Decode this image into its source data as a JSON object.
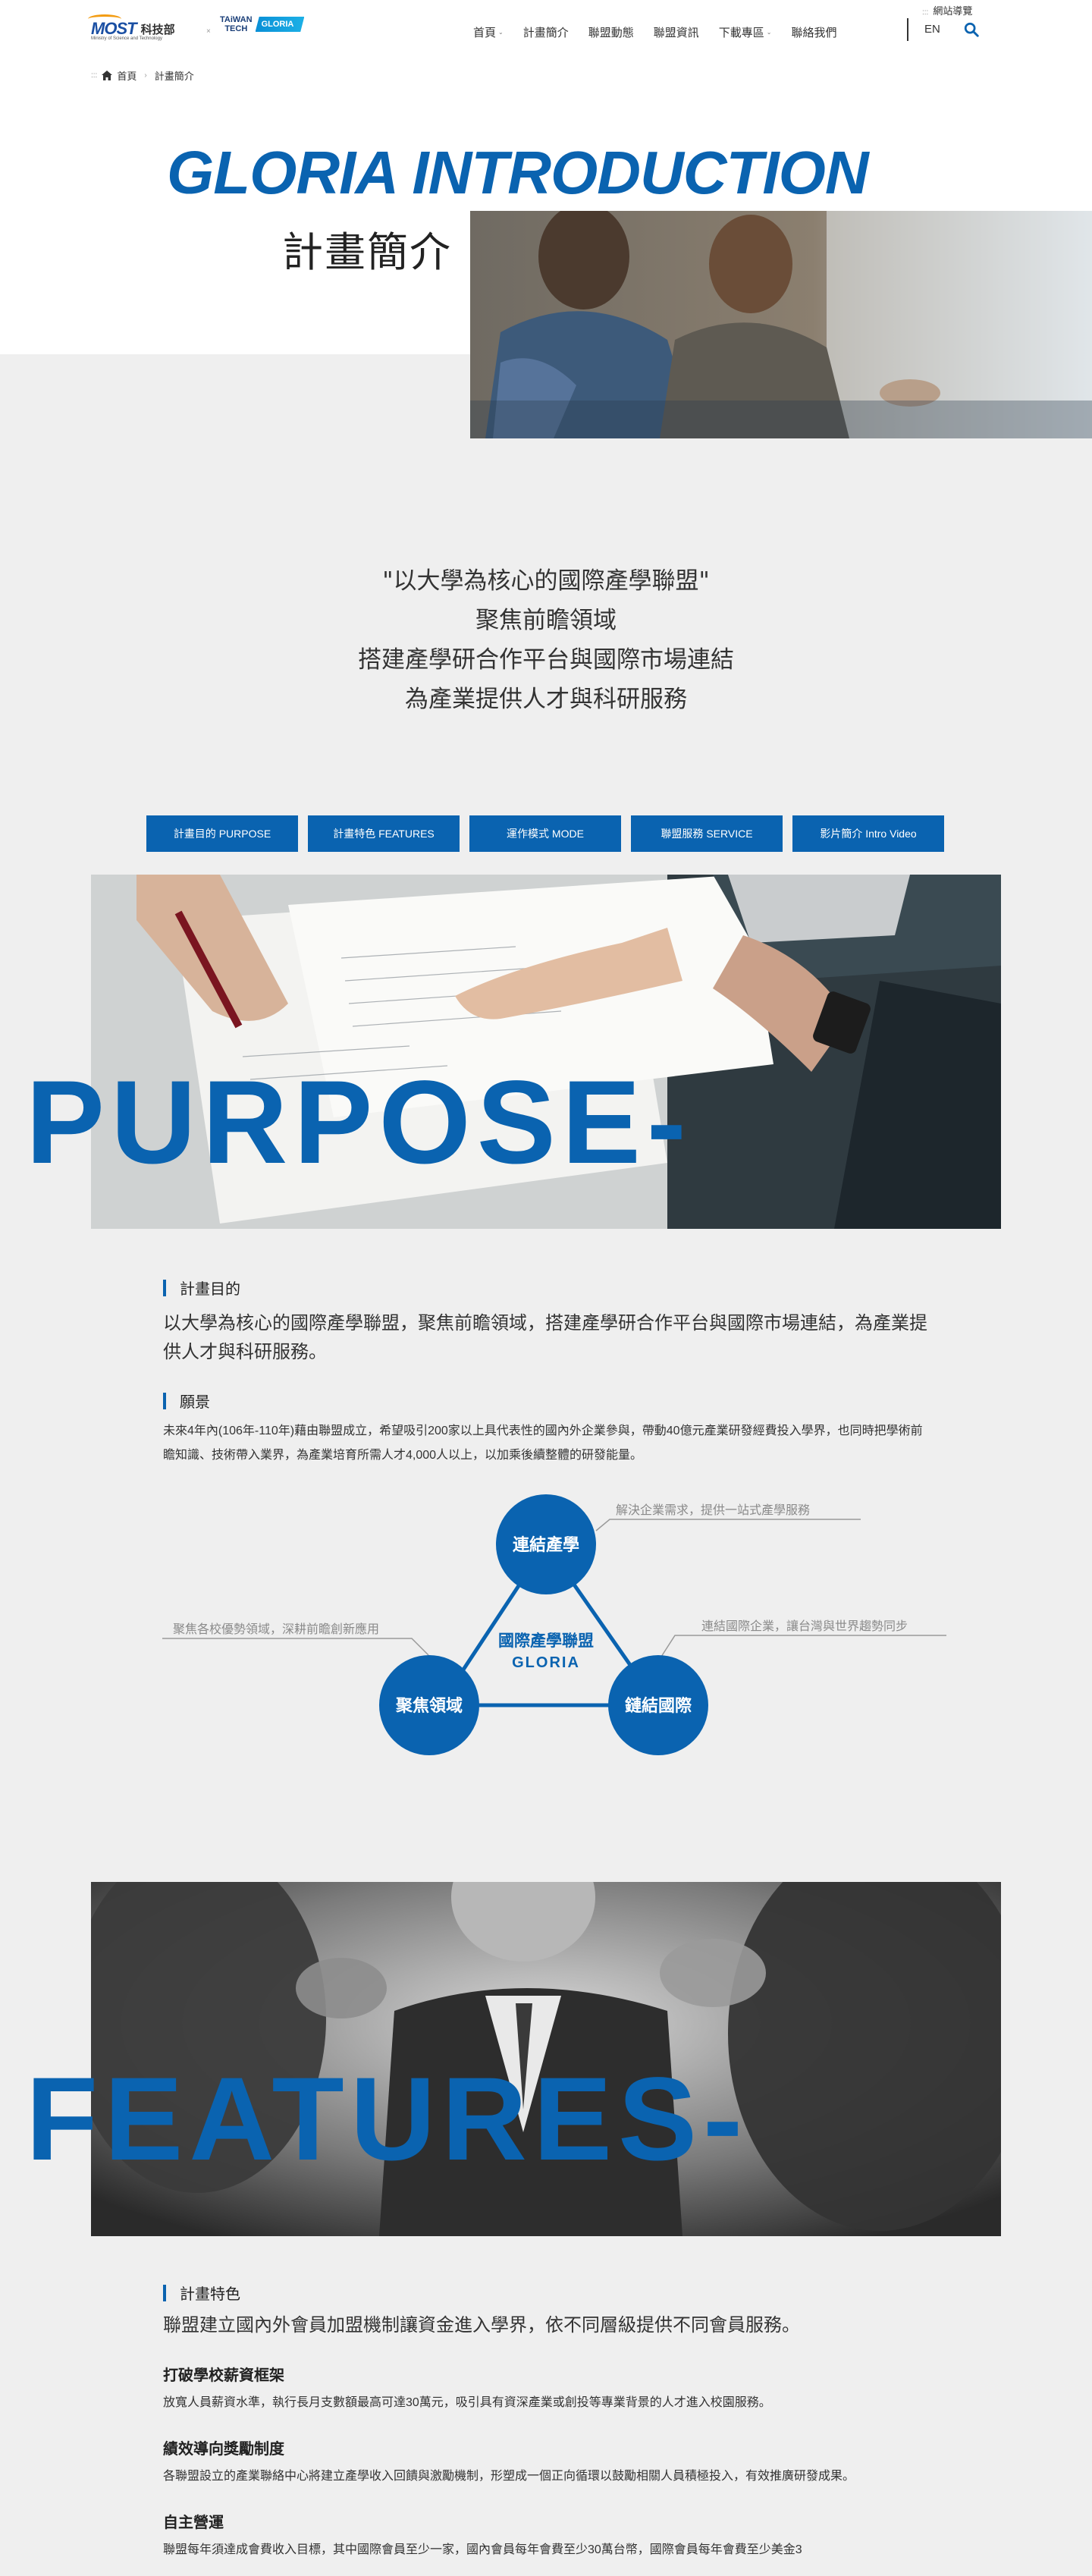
{
  "header": {
    "logo_most_text": "MOST",
    "logo_most_zh": "科技部",
    "logo_most_sub": "Ministry of Science and Technology",
    "logo_tt_line1": "TAiWAN",
    "logo_tt_line2": "TECH",
    "logo_gloria": "GLORIA",
    "nav": [
      {
        "label": "首頁",
        "caret": true
      },
      {
        "label": "計畫簡介",
        "caret": false
      },
      {
        "label": "聯盟動態",
        "caret": false
      },
      {
        "label": "聯盟資訊",
        "caret": false
      },
      {
        "label": "下載專區",
        "caret": true
      },
      {
        "label": "聯絡我們",
        "caret": false
      }
    ],
    "sitemap": "網站導覽",
    "lang": "EN"
  },
  "breadcrumb": {
    "home": "首頁",
    "current": "計畫簡介"
  },
  "hero": {
    "title_en": "GLORIA INTRODUCTION",
    "title_zh": "計畫簡介"
  },
  "slogan": [
    "\"以大學為核心的國際產學聯盟\"",
    "聚焦前瞻領域",
    "搭建產學研合作平台與國際市場連結",
    "為產業提供人才與科研服務"
  ],
  "tabs": [
    "計畫目的 PURPOSE",
    "計畫特色 FEATURES",
    "運作模式 MODE",
    "聯盟服務 SERVICE",
    "影片簡介 Intro Video"
  ],
  "purpose": {
    "big_word": "PURPOSE-",
    "heading": "計畫目的",
    "lead": "以大學為核心的國際產學聯盟，聚焦前瞻領域，搭建產學研合作平台與國際市場連結，為產業提供人才與科研服務。",
    "vision_heading": "願景",
    "vision_text": "未來4年內(106年-110年)藉由聯盟成立，希望吸引200家以上具代表性的國內外企業參與，帶動40億元產業研發經費投入學界，也同時把學術前瞻知識、技術帶入業界，為產業培育所需人才4,000人以上，以加乘後續整體的研發能量。"
  },
  "diagram": {
    "center_zh": "國際產學聯盟",
    "center_en": "GLORIA",
    "node_top": "連結產學",
    "node_left": "聚焦領域",
    "node_right": "鏈結國際",
    "note_top": "解決企業需求，提供一站式產學服務",
    "note_left": "聚焦各校優勢領域，深耕前瞻創新應用",
    "note_right": "連結國際企業，讓台灣與世界趨勢同步",
    "color": "#0a63b0"
  },
  "features": {
    "big_word": "FEATURES-",
    "heading": "計畫特色",
    "lead": "聯盟建立國內外會員加盟機制讓資金進入學界，依不同層級提供不同會員服務。",
    "items": [
      {
        "title": "打破學校薪資框架",
        "text": "放寬人員薪資水準，執行長月支數額最高可達30萬元，吸引具有資深產業或創投等專業背景的人才進入校園服務。"
      },
      {
        "title": "績效導向獎勵制度",
        "text": "各聯盟設立的產業聯絡中心將建立產學收入回饋與激勵機制，形塑成一個正向循環以鼓勵相關人員積極投入，有效推廣研發成果。"
      },
      {
        "title": "自主營運",
        "text": "聯盟每年須達成會費收入目標，其中國際會員至少一家，國內會員每年會費至少30萬台幣，國際會員每年會費至少美金3"
      }
    ]
  },
  "colors": {
    "brand": "#0a63b0",
    "bg": "#efefef"
  }
}
